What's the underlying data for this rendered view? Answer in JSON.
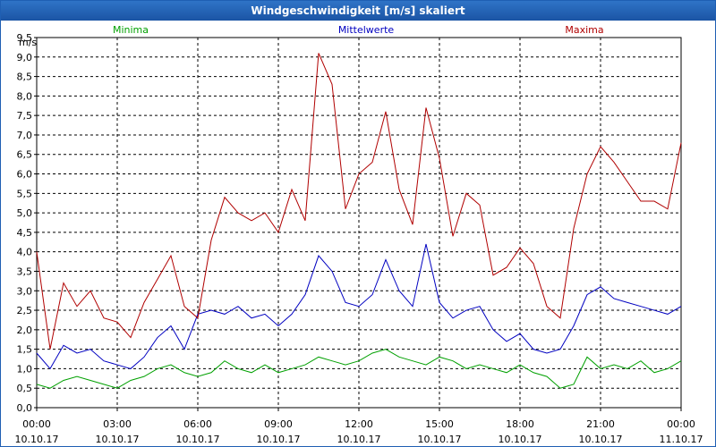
{
  "window": {
    "title": "Windgeschwindigkeit [m/s] skaliert"
  },
  "colors": {
    "titlebar": "#1b54a4",
    "minima": "#00a000",
    "mittelwerte": "#0000c0",
    "maxima": "#b00000",
    "grid": "#000000"
  },
  "chart_data": {
    "type": "line",
    "title": "Windgeschwindigkeit [m/s] skaliert",
    "ylabel": "m/s",
    "ylim": [
      0,
      9.5
    ],
    "yticks": [
      "0,0",
      "0,5",
      "1,0",
      "1,5",
      "2,0",
      "2,5",
      "3,0",
      "3,5",
      "4,0",
      "4,5",
      "5,0",
      "5,5",
      "6,0",
      "6,5",
      "7,0",
      "7,5",
      "8,0",
      "8,5",
      "9,0",
      "9,5"
    ],
    "xlim_hours": [
      0,
      24
    ],
    "xticks": [
      {
        "time": "00:00",
        "date": "10.10.17"
      },
      {
        "time": "03:00",
        "date": "10.10.17"
      },
      {
        "time": "06:00",
        "date": "10.10.17"
      },
      {
        "time": "09:00",
        "date": "10.10.17"
      },
      {
        "time": "12:00",
        "date": "10.10.17"
      },
      {
        "time": "15:00",
        "date": "10.10.17"
      },
      {
        "time": "18:00",
        "date": "10.10.17"
      },
      {
        "time": "21:00",
        "date": "10.10.17"
      },
      {
        "time": "00:00",
        "date": "11.10.17"
      }
    ],
    "grid": true,
    "x_hours": [
      0,
      0.5,
      1,
      1.5,
      2,
      2.5,
      3,
      3.5,
      4,
      4.5,
      5,
      5.5,
      6,
      6.5,
      7,
      7.5,
      8,
      8.5,
      9,
      9.5,
      10,
      10.5,
      11,
      11.5,
      12,
      12.5,
      13,
      13.5,
      14,
      14.5,
      15,
      15.5,
      16,
      16.5,
      17,
      17.5,
      18,
      18.5,
      19,
      19.5,
      20,
      20.5,
      21,
      21.5,
      22,
      22.5,
      23,
      23.5,
      24
    ],
    "series": [
      {
        "name": "Minima",
        "color": "#00a000",
        "values": [
          0.6,
          0.5,
          0.7,
          0.8,
          0.7,
          0.6,
          0.5,
          0.7,
          0.8,
          1.0,
          1.1,
          0.9,
          0.8,
          0.9,
          1.2,
          1.0,
          0.9,
          1.1,
          0.9,
          1.0,
          1.1,
          1.3,
          1.2,
          1.1,
          1.2,
          1.4,
          1.5,
          1.3,
          1.2,
          1.1,
          1.3,
          1.2,
          1.0,
          1.1,
          1.0,
          0.9,
          1.1,
          0.9,
          0.8,
          0.5,
          0.6,
          1.3,
          1.0,
          1.1,
          1.0,
          1.2,
          0.9,
          1.0,
          1.2
        ]
      },
      {
        "name": "Mittelwerte",
        "color": "#0000c0",
        "values": [
          1.4,
          1.0,
          1.6,
          1.4,
          1.5,
          1.2,
          1.1,
          1.0,
          1.3,
          1.8,
          2.1,
          1.5,
          2.4,
          2.5,
          2.4,
          2.6,
          2.3,
          2.4,
          2.1,
          2.4,
          2.9,
          3.9,
          3.5,
          2.7,
          2.6,
          2.9,
          3.8,
          3.0,
          2.6,
          4.2,
          2.7,
          2.3,
          2.5,
          2.6,
          2.0,
          1.7,
          1.9,
          1.5,
          1.4,
          1.5,
          2.1,
          2.9,
          3.1,
          2.8,
          2.7,
          2.6,
          2.5,
          2.4,
          2.6
        ]
      },
      {
        "name": "Maxima",
        "color": "#b00000",
        "values": [
          4.0,
          1.5,
          3.2,
          2.6,
          3.0,
          2.3,
          2.2,
          1.8,
          2.7,
          3.3,
          3.9,
          2.6,
          2.3,
          4.3,
          5.4,
          5.0,
          4.8,
          5.0,
          4.5,
          5.6,
          4.8,
          9.1,
          8.3,
          5.1,
          6.0,
          6.3,
          7.6,
          5.6,
          4.7,
          7.7,
          6.4,
          4.4,
          5.5,
          5.2,
          3.4,
          3.6,
          4.1,
          3.7,
          2.6,
          2.3,
          4.6,
          6.0,
          6.7,
          6.3,
          5.8,
          5.3,
          5.3,
          5.1,
          6.8
        ]
      }
    ]
  }
}
